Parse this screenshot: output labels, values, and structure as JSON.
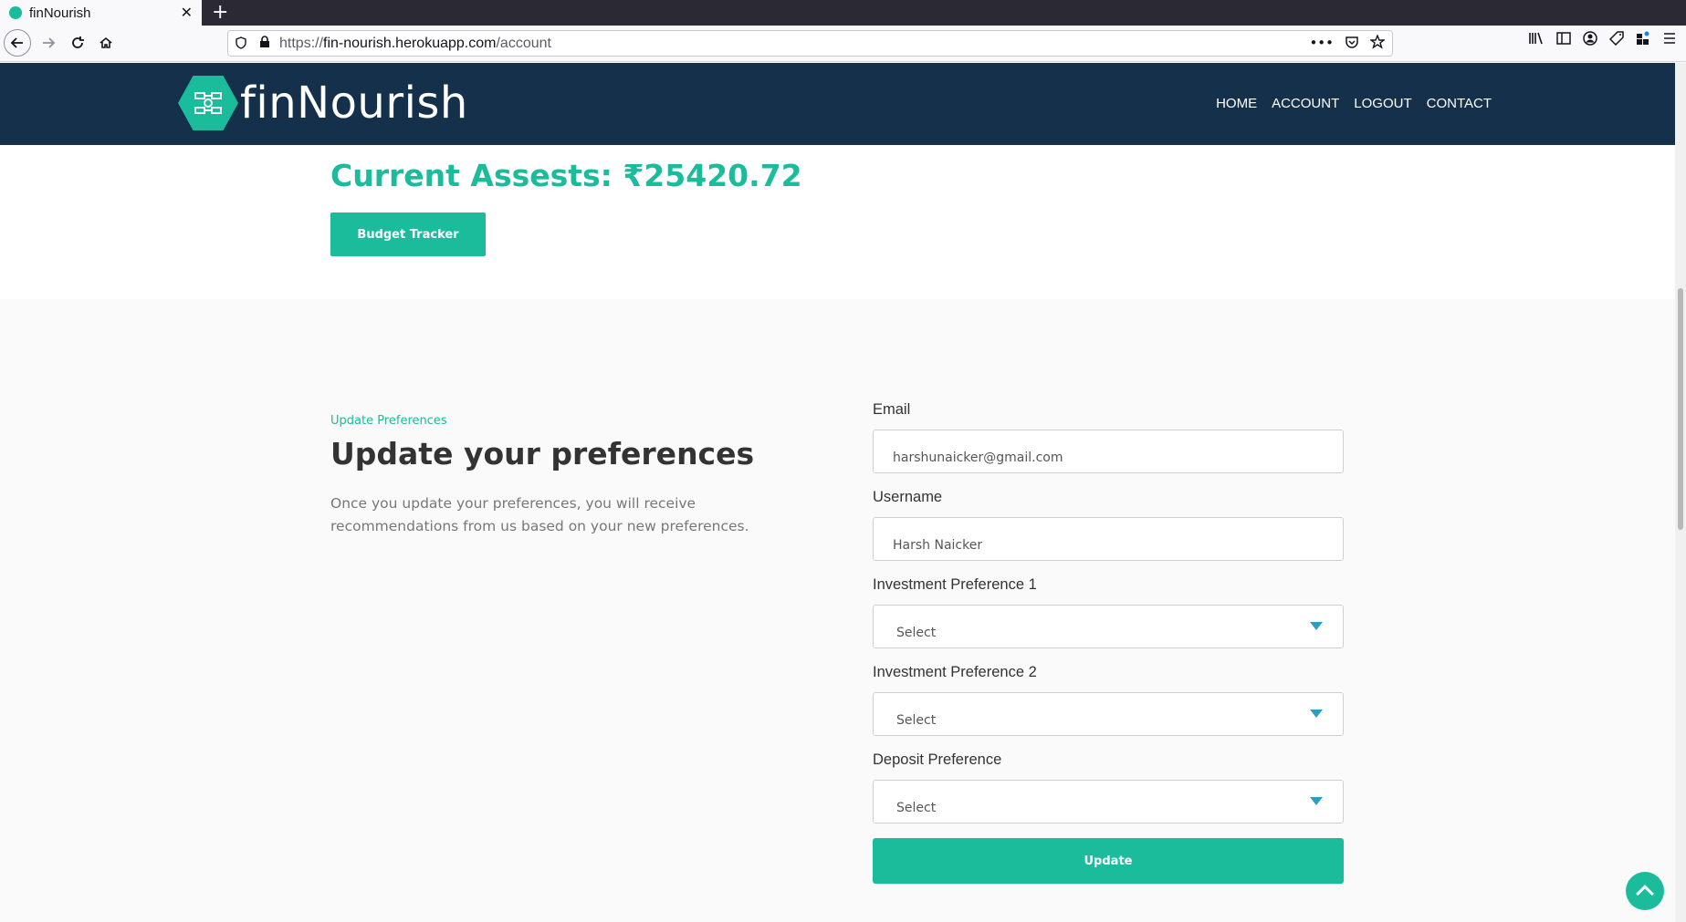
{
  "browser": {
    "tab_title": "finNourish",
    "tab_close": "✕",
    "new_tab": "+",
    "url_prefix": "https://",
    "url_host": "fin-nourish.herokuapp.com",
    "url_path": "/account",
    "icons": [
      "back-icon",
      "forward-icon",
      "reload-icon",
      "home-icon",
      "shield-icon",
      "lock-icon",
      "more-icon",
      "pocket-icon",
      "star-icon",
      "library-icon",
      "sidebar-icon",
      "account-icon",
      "tag-icon",
      "extensions-icon",
      "menu-icon"
    ]
  },
  "header": {
    "logo_text": "finNourish",
    "nav": [
      "HOME",
      "ACCOUNT",
      "LOGOUT",
      "CONTACT"
    ]
  },
  "assets": {
    "title": "Current Assests: ₹25420.72",
    "budget_button": "Budget Tracker"
  },
  "preferences": {
    "eyebrow": "Update Preferences",
    "title": "Update your preferences",
    "description": "Once you update your preferences, you will receive recommendations from us based on your new preferences.",
    "email_label": "Email",
    "email_value": "harshunaicker@gmail.com",
    "username_label": "Username",
    "username_value": "Harsh Naicker",
    "inv_pref1_label": "Investment Preference 1",
    "inv_pref1_value": "Select",
    "inv_pref2_label": "Investment Preference 2",
    "inv_pref2_value": "Select",
    "deposit_label": "Deposit Preference",
    "deposit_value": "Select",
    "update_button": "Update"
  },
  "colors": {
    "accent": "#1abc9c",
    "header_bg": "#14304a",
    "caret": "#3399cc"
  }
}
